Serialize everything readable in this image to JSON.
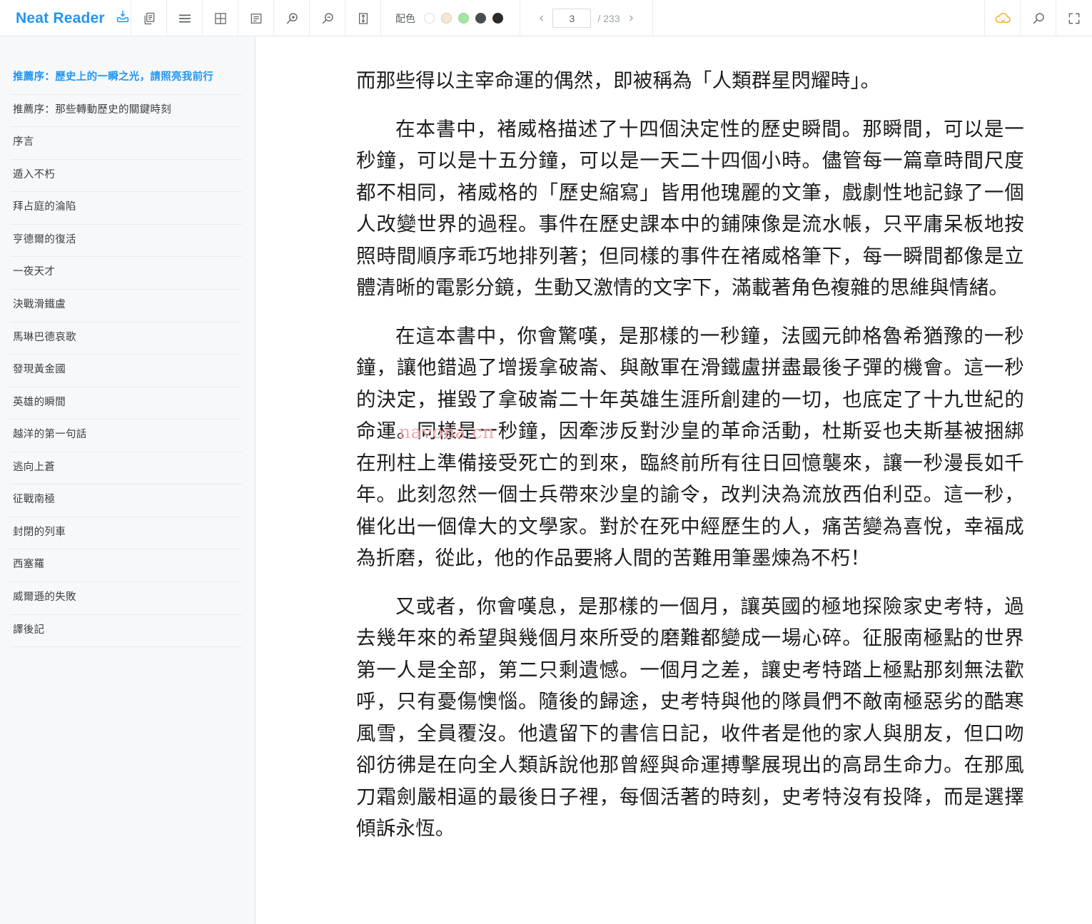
{
  "toolbar": {
    "brand": "Neat Reader",
    "icons": [
      {
        "name": "save-to-library-icon",
        "title": "save"
      },
      {
        "name": "copy-icon",
        "title": "copy"
      },
      {
        "name": "menu-icon",
        "title": "menu"
      },
      {
        "name": "grid-layout-icon",
        "title": "layout"
      },
      {
        "name": "notes-icon",
        "title": "notes"
      },
      {
        "name": "zoom-in-icon",
        "title": "zoom in"
      },
      {
        "name": "zoom-out-icon",
        "title": "zoom out"
      },
      {
        "name": "line-height-icon",
        "title": "line height"
      }
    ],
    "color_label": "配色",
    "swatches": [
      {
        "name": "theme-white",
        "color": "#ffffff",
        "border": "#dcdcdc",
        "selected": false
      },
      {
        "name": "theme-sepia",
        "color": "#f2e8d5",
        "border": "#dbcdb2",
        "selected": false
      },
      {
        "name": "theme-green",
        "color": "#a4e6a0",
        "border": "#8fd38b",
        "selected": true
      },
      {
        "name": "theme-dark-gray",
        "color": "#4a4d50",
        "border": "#4a4d50",
        "selected": false
      },
      {
        "name": "theme-black",
        "color": "#2b2b2b",
        "border": "#2b2b2b",
        "selected": false
      }
    ],
    "pager": {
      "prev_label": "‹",
      "next_label": "›",
      "current_page": "3",
      "total_label": "/ 233",
      "placeholder": "3"
    },
    "right_icons": [
      {
        "name": "cloud-sync-icon",
        "title": "cloud",
        "color": "#f5a623"
      },
      {
        "name": "search-icon",
        "title": "search",
        "color": "#5f6368"
      },
      {
        "name": "fullscreen-icon",
        "title": "fullscreen",
        "color": "#5f6368"
      }
    ]
  },
  "sidebar": {
    "items": [
      {
        "label": "推薦序：歷史上的一瞬之光，請照亮我前行",
        "active": true
      },
      {
        "label": "推薦序：那些轉動歷史的關鍵時刻",
        "active": false
      },
      {
        "label": "序言",
        "active": false
      },
      {
        "label": "遁入不朽",
        "active": false
      },
      {
        "label": "拜占庭的淪陷",
        "active": false
      },
      {
        "label": "亨德爾的復活",
        "active": false
      },
      {
        "label": "一夜天才",
        "active": false
      },
      {
        "label": "決戰滑鐵盧",
        "active": false
      },
      {
        "label": "馬琳巴德哀歌",
        "active": false
      },
      {
        "label": "發現黃金國",
        "active": false
      },
      {
        "label": "英雄的瞬間",
        "active": false
      },
      {
        "label": "越洋的第一句話",
        "active": false
      },
      {
        "label": "逃向上蒼",
        "active": false
      },
      {
        "label": "征戰南極",
        "active": false
      },
      {
        "label": "封閉的列車",
        "active": false
      },
      {
        "label": "西塞羅",
        "active": false
      },
      {
        "label": "威爾遜的失敗",
        "active": false
      },
      {
        "label": "譯後記",
        "active": false
      }
    ]
  },
  "reader": {
    "watermark": "navona.cn",
    "paragraphs": [
      {
        "indent": false,
        "text": "而那些得以主宰命運的偶然，即被稱為「人類群星閃耀時」。"
      },
      {
        "indent": true,
        "text": "在本書中，褚威格描述了十四個決定性的歷史瞬間。那瞬間，可以是一秒鐘，可以是十五分鐘，可以是一天二十四個小時。儘管每一篇章時間尺度都不相同，褚威格的「歷史縮寫」皆用他瑰麗的文筆，戲劇性地記錄了一個人改變世界的過程。事件在歷史課本中的鋪陳像是流水帳，只平庸呆板地按照時間順序乖巧地排列著；但同樣的事件在褚威格筆下，每一瞬間都像是立體清晰的電影分鏡，生動又激情的文字下，滿載著角色複雜的思維與情緒。"
      },
      {
        "indent": true,
        "text": "在這本書中，你會驚嘆，是那樣的一秒鐘，法國元帥格魯希猶豫的一秒鐘，讓他錯過了增援拿破崙、與敵軍在滑鐵盧拼盡最後子彈的機會。這一秒的決定，摧毀了拿破崙二十年英雄生涯所創建的一切，也底定了十九世紀的命運。同樣是一秒鐘，因牽涉反對沙皇的革命活動，杜斯妥也夫斯基被捆綁在刑柱上準備接受死亡的到來，臨終前所有往日回憶襲來，讓一秒漫長如千年。此刻忽然一個士兵帶來沙皇的諭令，改判決為流放西伯利亞。這一秒，催化出一個偉大的文學家。對於在死中經歷生的人，痛苦變為喜悅，幸福成為折磨，從此，他的作品要將人間的苦難用筆墨煉為不朽！"
      },
      {
        "indent": true,
        "text": "又或者，你會嘆息，是那樣的一個月，讓英國的極地探險家史考特，過去幾年來的希望與幾個月來所受的磨難都變成一場心碎。征服南極點的世界第一人是全部，第二只剩遺憾。一個月之差，讓史考特踏上極點那刻無法歡呼，只有憂傷懊惱。隨後的歸途，史考特與他的隊員們不敵南極惡劣的酷寒風雪，全員覆沒。他遺留下的書信日記，收件者是他的家人與朋友，但口吻卻彷彿是在向全人類訴說他那曾經與命運搏擊展現出的高昂生命力。在那風刀霜劍嚴相逼的最後日子裡，每個活著的時刻，史考特沒有投降，而是選擇傾訴永恆。"
      }
    ]
  }
}
